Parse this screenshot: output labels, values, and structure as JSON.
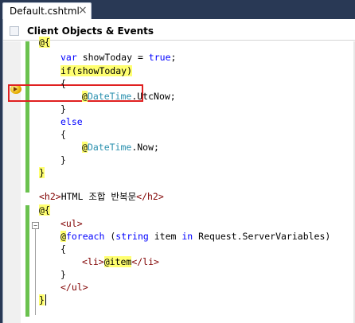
{
  "tab": {
    "title": "Default.cshtml",
    "close_glyph": "×"
  },
  "header": {
    "title": "Client Objects & Events"
  },
  "code": {
    "l1": [
      "@{"
    ],
    "l2": [
      "var",
      " showToday = ",
      "true",
      ";"
    ],
    "l3": [
      "if(showToday)"
    ],
    "l4": [
      "{"
    ],
    "l5": [
      "@",
      "DateTime",
      ".UtcNow;"
    ],
    "l6": [
      "}"
    ],
    "l7": [
      "else"
    ],
    "l8": [
      "{"
    ],
    "l9": [
      "@",
      "DateTime",
      ".Now;"
    ],
    "l10": [
      "}"
    ],
    "l11": [
      "}"
    ],
    "l12": [
      "<h2>",
      "HTML 조합 반복문",
      "</h2>"
    ],
    "l13": [
      "@{"
    ],
    "l14": [
      "<ul>"
    ],
    "l15": [
      "@",
      "foreach",
      " (",
      "string",
      " item ",
      "in",
      " Request.ServerVariables)"
    ],
    "l16": [
      "{"
    ],
    "l17": [
      "<li>",
      "@item",
      "</li>"
    ],
    "l18": [
      "}"
    ],
    "l19": [
      "</ul>"
    ],
    "l20": [
      "}"
    ]
  },
  "fold_glyph": "−",
  "colors": {
    "keyword": "#0000ff",
    "type": "#2b91af",
    "tag": "#800000",
    "razor_highlight": "#ffff70",
    "change_bar": "#6bc24f",
    "highlight_box": "#e02020"
  },
  "icons": {
    "breakpoint": "current-statement-breakpoint-icon"
  }
}
